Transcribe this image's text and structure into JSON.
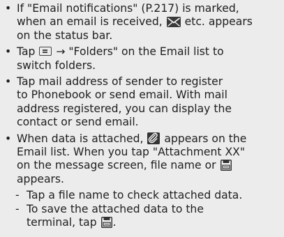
{
  "bullets": [
    {
      "l1": "If \"Email notifications\" (P.217) is marked,",
      "l2a": "when an email is received,",
      "l2b": "etc. appears",
      "l3": "on the status bar."
    },
    {
      "l1a": "Tap",
      "l1b": "→ \"Folders\" on the Email list to",
      "l2": "switch folders."
    },
    {
      "l1": "Tap mail address of sender to register",
      "l2": "to Phonebook or send email. With mail",
      "l3": "address registered, you can display the",
      "l4": "contact or send email."
    },
    {
      "l1a": "When data is attached,",
      "l1b": "appears on the",
      "l2": "Email list. When you tap \"Attachment XX\"",
      "l3": "on the message screen, file name or",
      "l4": "appears.",
      "subs": [
        {
          "l1": "Tap a file name to check attached data."
        },
        {
          "l1": "To save the attached data to the",
          "l2a": "terminal, tap",
          "l2b": "."
        }
      ]
    }
  ],
  "bullet_symbol": "•",
  "dash_symbol": "-",
  "icons": {
    "mail_notification": "new-mail-status-icon",
    "menu": "menu-key-icon",
    "attachment": "paperclip-icon",
    "save": "save-disk-icon"
  }
}
